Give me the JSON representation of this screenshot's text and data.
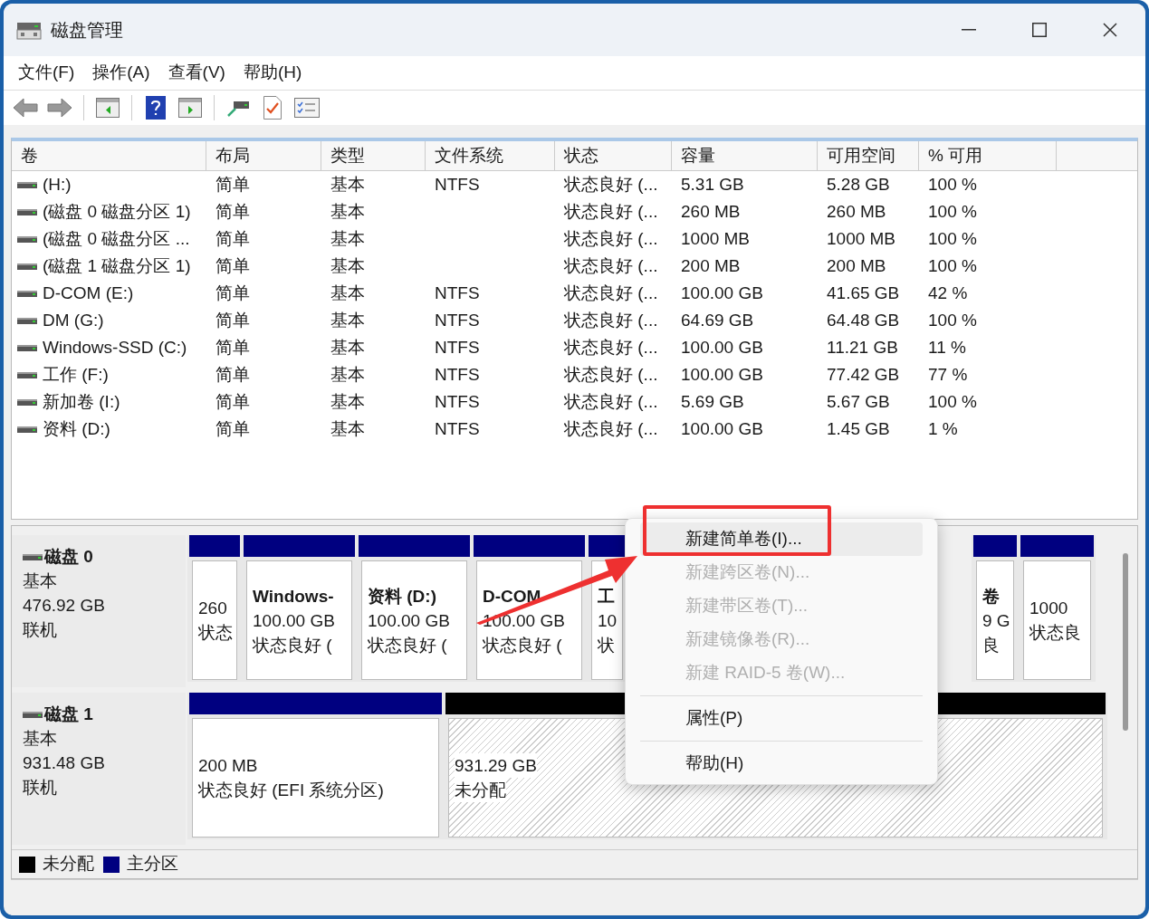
{
  "window": {
    "title": "磁盘管理"
  },
  "menu_bar": [
    "文件(F)",
    "操作(A)",
    "查看(V)",
    "帮助(H)"
  ],
  "volume_list": {
    "columns": [
      "卷",
      "布局",
      "类型",
      "文件系统",
      "状态",
      "容量",
      "可用空间",
      "% 可用"
    ],
    "rows": [
      [
        "(H:)",
        "简单",
        "基本",
        "NTFS",
        "状态良好 (...",
        "5.31 GB",
        "5.28 GB",
        "100 %"
      ],
      [
        "(磁盘 0 磁盘分区 1)",
        "简单",
        "基本",
        "",
        "状态良好 (...",
        "260 MB",
        "260 MB",
        "100 %"
      ],
      [
        "(磁盘 0 磁盘分区 ...",
        "简单",
        "基本",
        "",
        "状态良好 (...",
        "1000 MB",
        "1000 MB",
        "100 %"
      ],
      [
        "(磁盘 1 磁盘分区 1)",
        "简单",
        "基本",
        "",
        "状态良好 (...",
        "200 MB",
        "200 MB",
        "100 %"
      ],
      [
        "D-COM (E:)",
        "简单",
        "基本",
        "NTFS",
        "状态良好 (...",
        "100.00 GB",
        "41.65 GB",
        "42 %"
      ],
      [
        "DM (G:)",
        "简单",
        "基本",
        "NTFS",
        "状态良好 (...",
        "64.69 GB",
        "64.48 GB",
        "100 %"
      ],
      [
        "Windows-SSD (C:)",
        "简单",
        "基本",
        "NTFS",
        "状态良好 (...",
        "100.00 GB",
        "11.21 GB",
        "11 %"
      ],
      [
        "工作 (F:)",
        "简单",
        "基本",
        "NTFS",
        "状态良好 (...",
        "100.00 GB",
        "77.42 GB",
        "77 %"
      ],
      [
        "新加卷 (I:)",
        "简单",
        "基本",
        "NTFS",
        "状态良好 (...",
        "5.69 GB",
        "5.67 GB",
        "100 %"
      ],
      [
        "资料 (D:)",
        "简单",
        "基本",
        "NTFS",
        "状态良好 (...",
        "100.00 GB",
        "1.45 GB",
        "1 %"
      ]
    ]
  },
  "disks": [
    {
      "name": "磁盘 0",
      "type": "基本",
      "size": "476.92 GB",
      "status": "联机",
      "partitions": [
        {
          "kind": "primary",
          "size": "260",
          "status": "状态"
        },
        {
          "kind": "primary",
          "name": "Windows-",
          "size": "100.00 GB",
          "status": "状态良好 ("
        },
        {
          "kind": "primary",
          "name": "资料 (D:)",
          "size": "100.00 GB",
          "status": "状态良好 ("
        },
        {
          "kind": "primary",
          "name": "D-COM",
          "size": "100.00 GB",
          "status": "状态良好 ("
        },
        {
          "kind": "primary",
          "name": "工",
          "size": "10",
          "status": "状"
        },
        {
          "kind": "hidden"
        },
        {
          "kind": "primary",
          "name": "卷",
          "size": "9 G",
          "status": "良"
        },
        {
          "kind": "primary",
          "size": "1000",
          "status": "状态良"
        }
      ]
    },
    {
      "name": "磁盘 1",
      "type": "基本",
      "size": "931.48 GB",
      "status": "联机",
      "partitions": [
        {
          "kind": "primary",
          "size": "200 MB",
          "status": "状态良好 (EFI 系统分区)"
        },
        {
          "kind": "unallocated",
          "size": "931.29 GB",
          "status": "未分配"
        }
      ]
    }
  ],
  "legend": [
    {
      "label": "未分配",
      "color": "#000000"
    },
    {
      "label": "主分区",
      "color": "#000080"
    }
  ],
  "context_menu": [
    {
      "kind": "item",
      "label": "新建简单卷(I)...",
      "disabled": false,
      "selected": true
    },
    {
      "kind": "item",
      "label": "新建跨区卷(N)...",
      "disabled": true,
      "selected": false
    },
    {
      "kind": "item",
      "label": "新建带区卷(T)...",
      "disabled": true,
      "selected": false
    },
    {
      "kind": "item",
      "label": "新建镜像卷(R)...",
      "disabled": true,
      "selected": false
    },
    {
      "kind": "item",
      "label": "新建 RAID-5 卷(W)...",
      "disabled": true,
      "selected": false
    },
    {
      "kind": "separator"
    },
    {
      "kind": "item",
      "label": "属性(P)",
      "disabled": false,
      "selected": false
    },
    {
      "kind": "separator"
    },
    {
      "kind": "item",
      "label": "帮助(H)",
      "disabled": false,
      "selected": false
    }
  ]
}
